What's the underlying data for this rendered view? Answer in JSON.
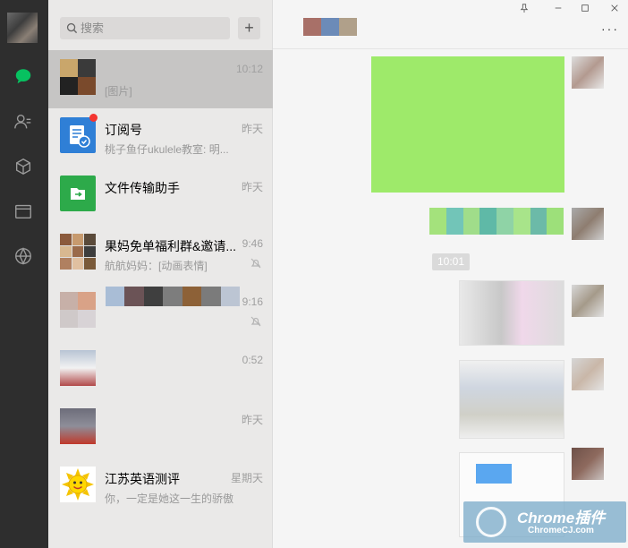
{
  "search": {
    "placeholder": "搜索"
  },
  "add_label": "+",
  "chats": [
    {
      "name": "",
      "preview": "[图片]",
      "time": "10:12"
    },
    {
      "name": "订阅号",
      "preview": "桃子鱼仔ukulele教室: 明...",
      "time": "昨天"
    },
    {
      "name": "文件传输助手",
      "preview": "",
      "time": "昨天"
    },
    {
      "name": "果妈免单福利群&邀请...",
      "preview": "航航妈妈：[动画表情]",
      "time": "9:46"
    },
    {
      "name": "",
      "preview": "",
      "time": "9:16"
    },
    {
      "name": "",
      "preview": "",
      "time": "0:52"
    },
    {
      "name": "",
      "preview": "",
      "time": "昨天"
    },
    {
      "name": "江苏英语测评",
      "preview": "你，一定是她这一生的骄傲",
      "time": "星期天"
    }
  ],
  "chat": {
    "time_chip": "10:01",
    "more": "···"
  },
  "watermark": {
    "brand": "Chrome插件",
    "url": "ChromeCJ.com"
  },
  "colors": {
    "rail": "#2e2e2e",
    "accent_green": "#07c160",
    "bubble": "#9eea6a"
  }
}
